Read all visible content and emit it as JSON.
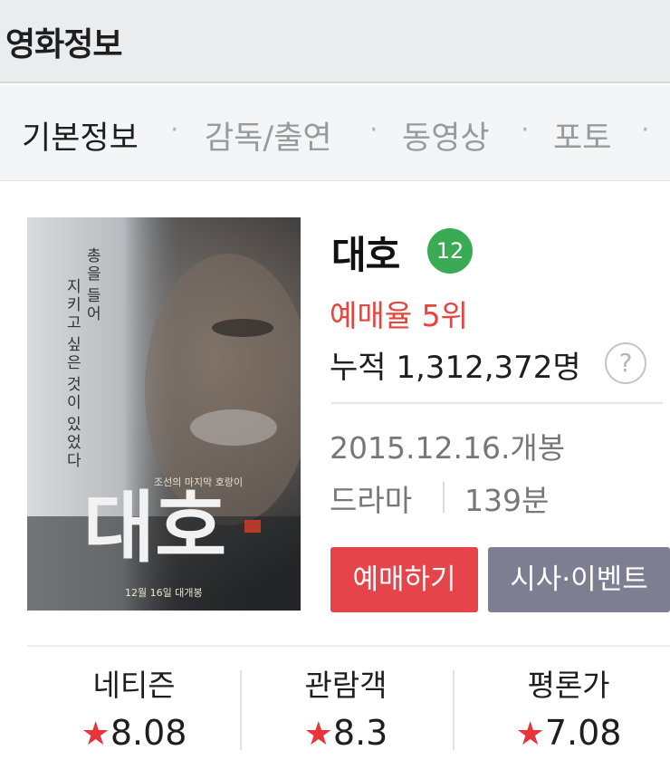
{
  "header": {
    "title": "영화정보"
  },
  "tabs": [
    {
      "label": "기본정보",
      "active": true
    },
    {
      "label": "감독/출연",
      "active": false
    },
    {
      "label": "동영상",
      "active": false
    },
    {
      "label": "포토",
      "active": false
    }
  ],
  "tab_separator": "·",
  "poster": {
    "tagline": "총을 들어 지키고 싶은 것이 있었다",
    "subtitle": "조선의 마지막 호랑이",
    "title_art": "대호",
    "release_line": "12월 16일 대개봉"
  },
  "movie": {
    "title": "대호",
    "age_rating": "12",
    "booking_rank": "예매율 5위",
    "audience": "누적 1,312,372명",
    "help_symbol": "?",
    "release": "2015.12.16.개봉",
    "genre": "드라마",
    "runtime": "139분"
  },
  "buttons": {
    "book": "예매하기",
    "event": "시사·이벤트"
  },
  "scores": [
    {
      "label": "네티즌",
      "value": "8.08"
    },
    {
      "label": "관람객",
      "value": "8.3"
    },
    {
      "label": "평론가",
      "value": "7.08"
    }
  ],
  "star_glyph": "★",
  "colors": {
    "accent_red": "#e8443f",
    "book_button": "#e5454a",
    "event_button": "#7e7e93",
    "age_badge": "#3aaa55"
  }
}
